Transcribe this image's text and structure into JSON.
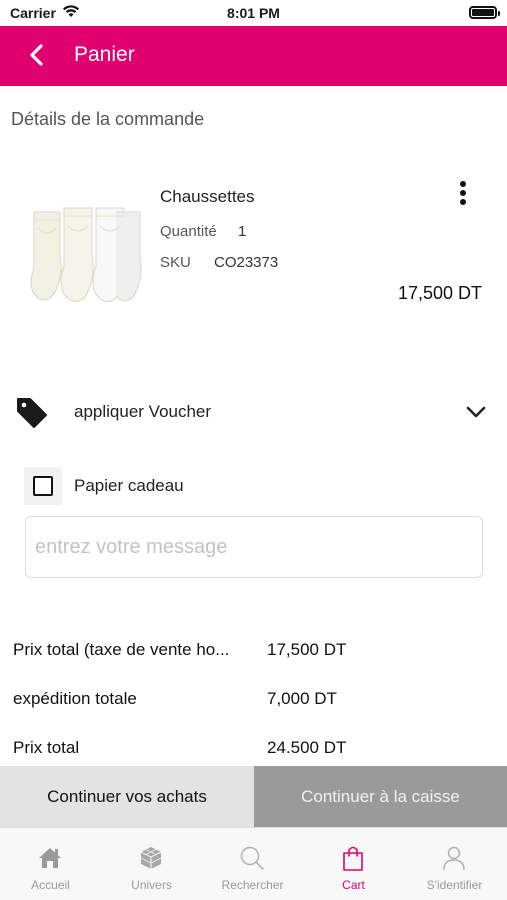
{
  "status_bar": {
    "carrier": "Carrier",
    "time": "8:01 PM"
  },
  "nav": {
    "title": "Panier",
    "back_icon": "chevron-left-icon"
  },
  "section_title": "Détails de la commande",
  "product": {
    "name": "Chaussettes",
    "quantity_label": "Quantité",
    "quantity_value": "1",
    "sku_label": "SKU",
    "sku_value": "CO23373",
    "price": "17,500 DT"
  },
  "voucher": {
    "label": "appliquer Voucher"
  },
  "gift": {
    "label": "Papier cadeau",
    "checked": false
  },
  "message": {
    "placeholder": "entrez votre message",
    "value": ""
  },
  "totals": [
    {
      "label": "Prix total (taxe de vente ho...",
      "value": "17,500 DT"
    },
    {
      "label": "expédition totale",
      "value": "7,000 DT"
    },
    {
      "label": "Prix total",
      "value": "24.500 DT"
    }
  ],
  "actions": {
    "continue_label": "Continuer vos achats",
    "checkout_label": "Continuer à la caisse"
  },
  "tabs": [
    {
      "label": "Accueil",
      "icon": "home-icon"
    },
    {
      "label": "Univers",
      "icon": "cube-icon"
    },
    {
      "label": "Rechercher",
      "icon": "search-icon"
    },
    {
      "label": "Cart",
      "icon": "shopping-bag-icon",
      "active": true
    },
    {
      "label": "S'identifier",
      "icon": "user-icon"
    }
  ],
  "colors": {
    "brand": "#e0006f",
    "checkout_bg": "#9a9a9a",
    "continue_bg": "#e3e3e3"
  }
}
